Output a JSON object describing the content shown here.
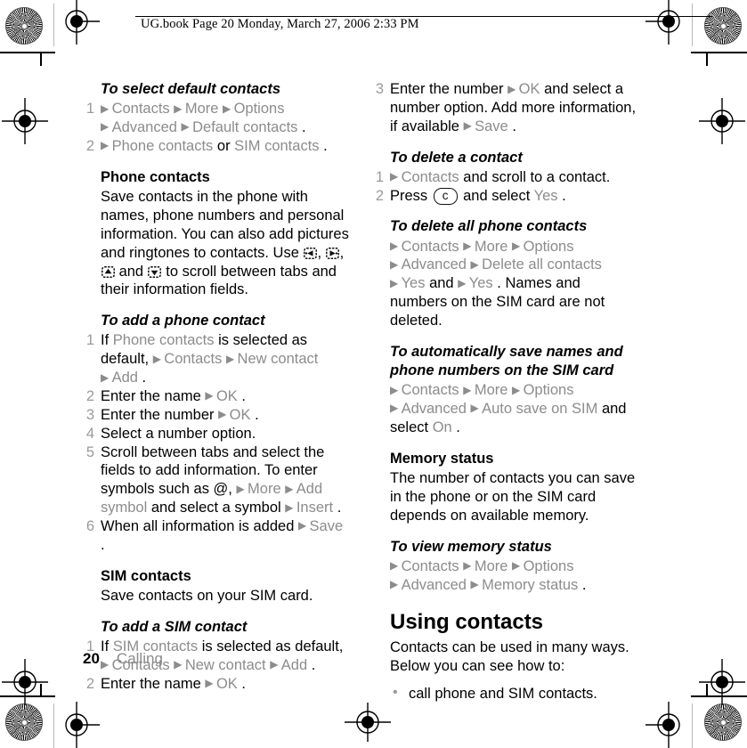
{
  "header": {
    "slug": "UG.book  Page 20  Monday, March 27, 2006  2:33 PM"
  },
  "colors": {
    "ui_gray": "#8c8c8c",
    "number_gray": "#9a9a9a",
    "text_black": "#000000",
    "page_background": "#ffffff"
  },
  "footer": {
    "page_number": "20",
    "chapter": "Calling"
  },
  "left_column": {
    "sections": [
      {
        "heading": "To select default contacts",
        "heading_style": "bold-italic",
        "steps": [
          {
            "number": "1",
            "parts": [
              {
                "t": "arrow"
              },
              {
                "t": "ui",
                "v": "Contacts"
              },
              {
                "t": "arrow"
              },
              {
                "t": "ui",
                "v": "More"
              },
              {
                "t": "arrow"
              },
              {
                "t": "ui",
                "v": "Options"
              },
              {
                "t": "arrow"
              },
              {
                "t": "ui",
                "v": "Advanced"
              },
              {
                "t": "arrow"
              },
              {
                "t": "ui",
                "v": "Default contacts"
              },
              {
                "t": "plain",
                "v": "."
              }
            ]
          },
          {
            "number": "2",
            "parts": [
              {
                "t": "arrow"
              },
              {
                "t": "ui",
                "v": "Phone contacts"
              },
              {
                "t": "plain",
                "v": " or "
              },
              {
                "t": "ui",
                "v": "SIM contacts"
              },
              {
                "t": "plain",
                "v": "."
              }
            ]
          }
        ]
      },
      {
        "heading": "Phone contacts",
        "heading_style": "bold",
        "paragraph_parts": [
          {
            "t": "plain",
            "v": "Save contacts in the phone with names, phone numbers and personal information. You can also add pictures and ringtones to contacts. Use "
          },
          {
            "t": "icon",
            "v": "nav-left-key-icon"
          },
          {
            "t": "plain",
            "v": ", "
          },
          {
            "t": "icon",
            "v": "nav-right-key-icon"
          },
          {
            "t": "plain",
            "v": ", "
          },
          {
            "t": "icon",
            "v": "nav-up-key-icon"
          },
          {
            "t": "plain",
            "v": " and "
          },
          {
            "t": "icon",
            "v": "nav-down-key-icon"
          },
          {
            "t": "plain",
            "v": " to scroll between tabs and their information fields."
          }
        ]
      },
      {
        "heading": "To add a phone contact",
        "heading_style": "bold-italic",
        "steps": [
          {
            "number": "1",
            "parts": [
              {
                "t": "plain",
                "v": "If "
              },
              {
                "t": "ui",
                "v": "Phone contacts"
              },
              {
                "t": "plain",
                "v": " is selected as default, "
              },
              {
                "t": "arrow"
              },
              {
                "t": "ui",
                "v": "Contacts"
              },
              {
                "t": "arrow"
              },
              {
                "t": "ui",
                "v": "New contact"
              },
              {
                "t": "arrow"
              },
              {
                "t": "ui",
                "v": "Add"
              },
              {
                "t": "plain",
                "v": "."
              }
            ]
          },
          {
            "number": "2",
            "parts": [
              {
                "t": "plain",
                "v": "Enter the name "
              },
              {
                "t": "arrow"
              },
              {
                "t": "ui",
                "v": "OK"
              },
              {
                "t": "plain",
                "v": "."
              }
            ]
          },
          {
            "number": "3",
            "parts": [
              {
                "t": "plain",
                "v": "Enter the number "
              },
              {
                "t": "arrow"
              },
              {
                "t": "ui",
                "v": "OK"
              },
              {
                "t": "plain",
                "v": "."
              }
            ]
          },
          {
            "number": "4",
            "parts": [
              {
                "t": "plain",
                "v": "Select a number option."
              }
            ]
          },
          {
            "number": "5",
            "parts": [
              {
                "t": "plain",
                "v": "Scroll between tabs and select the fields to add information. To enter symbols such as @, "
              },
              {
                "t": "arrow"
              },
              {
                "t": "ui",
                "v": "More"
              },
              {
                "t": "arrow"
              },
              {
                "t": "ui",
                "v": "Add symbol"
              },
              {
                "t": "plain",
                "v": " and select a symbol "
              },
              {
                "t": "arrow"
              },
              {
                "t": "ui",
                "v": "Insert"
              },
              {
                "t": "plain",
                "v": "."
              }
            ]
          },
          {
            "number": "6",
            "parts": [
              {
                "t": "plain",
                "v": "When all information is added "
              },
              {
                "t": "arrow"
              },
              {
                "t": "ui",
                "v": "Save"
              },
              {
                "t": "plain",
                "v": "."
              }
            ]
          }
        ]
      },
      {
        "heading": "SIM contacts",
        "heading_style": "bold",
        "paragraph_parts": [
          {
            "t": "plain",
            "v": "Save contacts on your SIM card."
          }
        ]
      },
      {
        "heading": "To add a SIM contact",
        "heading_style": "bold-italic",
        "steps": [
          {
            "number": "1",
            "parts": [
              {
                "t": "plain",
                "v": "If "
              },
              {
                "t": "ui",
                "v": "SIM contacts"
              },
              {
                "t": "plain",
                "v": " is selected as default, "
              },
              {
                "t": "arrow"
              },
              {
                "t": "ui",
                "v": "Contacts"
              },
              {
                "t": "arrow"
              },
              {
                "t": "ui",
                "v": "New contact"
              },
              {
                "t": "arrow"
              },
              {
                "t": "ui",
                "v": "Add"
              },
              {
                "t": "plain",
                "v": "."
              }
            ]
          },
          {
            "number": "2",
            "parts": [
              {
                "t": "plain",
                "v": "Enter the name "
              },
              {
                "t": "arrow"
              },
              {
                "t": "ui",
                "v": "OK"
              },
              {
                "t": "plain",
                "v": "."
              }
            ]
          }
        ]
      }
    ]
  },
  "right_column": {
    "sections": [
      {
        "heading": null,
        "steps": [
          {
            "number": "3",
            "parts": [
              {
                "t": "plain",
                "v": "Enter the number "
              },
              {
                "t": "arrow"
              },
              {
                "t": "ui",
                "v": "OK"
              },
              {
                "t": "plain",
                "v": " and select a number option. Add more information, if available "
              },
              {
                "t": "arrow"
              },
              {
                "t": "ui",
                "v": "Save"
              },
              {
                "t": "plain",
                "v": "."
              }
            ]
          }
        ]
      },
      {
        "heading": "To delete a contact",
        "heading_style": "bold-italic",
        "steps": [
          {
            "number": "1",
            "parts": [
              {
                "t": "arrow"
              },
              {
                "t": "ui",
                "v": "Contacts"
              },
              {
                "t": "plain",
                "v": " and scroll to a contact."
              }
            ]
          },
          {
            "number": "2",
            "parts": [
              {
                "t": "plain",
                "v": "Press "
              },
              {
                "t": "ckey",
                "v": "c"
              },
              {
                "t": "plain",
                "v": " and select "
              },
              {
                "t": "ui",
                "v": "Yes"
              },
              {
                "t": "plain",
                "v": "."
              }
            ]
          }
        ]
      },
      {
        "heading": "To delete all phone contacts",
        "heading_style": "bold-italic",
        "pathline_parts": [
          {
            "t": "arrow"
          },
          {
            "t": "ui",
            "v": "Contacts"
          },
          {
            "t": "arrow"
          },
          {
            "t": "ui",
            "v": "More"
          },
          {
            "t": "arrow"
          },
          {
            "t": "ui",
            "v": "Options"
          },
          {
            "t": "arrow"
          },
          {
            "t": "ui",
            "v": "Advanced"
          },
          {
            "t": "arrow"
          },
          {
            "t": "ui",
            "v": "Delete all contacts"
          },
          {
            "t": "arrow"
          },
          {
            "t": "ui",
            "v": "Yes"
          },
          {
            "t": "plain",
            "v": " and "
          },
          {
            "t": "arrow"
          },
          {
            "t": "ui",
            "v": "Yes"
          },
          {
            "t": "plain",
            "v": ". Names and numbers on the SIM card are not deleted."
          }
        ]
      },
      {
        "heading": "To automatically save names and phone numbers on the SIM card",
        "heading_style": "bold-italic",
        "pathline_parts": [
          {
            "t": "arrow"
          },
          {
            "t": "ui",
            "v": "Contacts"
          },
          {
            "t": "arrow"
          },
          {
            "t": "ui",
            "v": "More"
          },
          {
            "t": "arrow"
          },
          {
            "t": "ui",
            "v": "Options"
          },
          {
            "t": "arrow"
          },
          {
            "t": "ui",
            "v": "Advanced"
          },
          {
            "t": "arrow"
          },
          {
            "t": "ui",
            "v": "Auto save on SIM"
          },
          {
            "t": "plain",
            "v": " and select "
          },
          {
            "t": "ui",
            "v": "On"
          },
          {
            "t": "plain",
            "v": "."
          }
        ]
      },
      {
        "heading": "Memory status",
        "heading_style": "bold",
        "paragraph_parts": [
          {
            "t": "plain",
            "v": "The number of contacts you can save in the phone or on the SIM card depends on available memory."
          }
        ]
      },
      {
        "heading": "To view memory status",
        "heading_style": "bold-italic",
        "pathline_parts": [
          {
            "t": "arrow"
          },
          {
            "t": "ui",
            "v": "Contacts"
          },
          {
            "t": "arrow"
          },
          {
            "t": "ui",
            "v": "More"
          },
          {
            "t": "arrow"
          },
          {
            "t": "ui",
            "v": "Options"
          },
          {
            "t": "arrow"
          },
          {
            "t": "ui",
            "v": "Advanced"
          },
          {
            "t": "arrow"
          },
          {
            "t": "ui",
            "v": "Memory status"
          },
          {
            "t": "plain",
            "v": "."
          }
        ]
      },
      {
        "heading": "Using contacts",
        "heading_style": "chapter",
        "paragraph_parts": [
          {
            "t": "plain",
            "v": "Contacts can be used in many ways. Below you can see how to:"
          }
        ],
        "bullets": [
          [
            {
              "t": "plain",
              "v": "call phone and SIM contacts."
            }
          ]
        ]
      }
    ]
  }
}
